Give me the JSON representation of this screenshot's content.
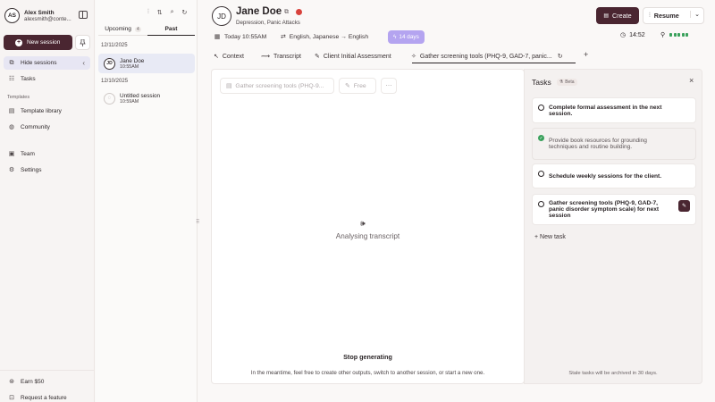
{
  "user": {
    "initials": "AS",
    "name": "Alex Smith",
    "email": "alexsmith@conte..."
  },
  "sidebar": {
    "new_session_label": "New session",
    "hide_sessions_label": "Hide sessions",
    "tasks_label": "Tasks",
    "templates_section": "Templates",
    "template_library_label": "Template library",
    "community_label": "Community",
    "team_label": "Team",
    "settings_label": "Settings",
    "earn_label": "Earn $50",
    "request_feature_label": "Request a feature"
  },
  "sessions_panel": {
    "tab_upcoming": "Upcoming",
    "tab_upcoming_badge": "4",
    "tab_past": "Past",
    "groups": [
      {
        "date": "12/11/2025",
        "name": "Jane Doe",
        "initials": "JD",
        "time": "10:55AM"
      },
      {
        "date": "12/10/2025",
        "name": "Untitled session",
        "initials": "",
        "time": "10:59AM"
      }
    ]
  },
  "patient": {
    "initials": "JD",
    "name": "Jane Doe",
    "conditions": "Depression, Panic Attacks",
    "date": "Today 10:55AM",
    "languages": "English, Japanese → English",
    "days_badge": "14 days",
    "timer": "14:52"
  },
  "header": {
    "create_label": "Create",
    "resume_label": "Resume"
  },
  "tabs": [
    {
      "label": "Context"
    },
    {
      "label": "Transcript"
    },
    {
      "label": "Client Initial Assessment"
    },
    {
      "label": "Gather screening tools (PHQ-9, GAD-7, panic..."
    }
  ],
  "editor": {
    "toolbar_template": "Gather screening tools (PHQ-9...",
    "toolbar_free": "Free",
    "status": "Analysing transcript",
    "stop_label": "Stop generating",
    "hint": "In the meantime, feel free to create other outputs, switch to another session, or start a new one."
  },
  "tasks_panel": {
    "title": "Tasks",
    "beta": "Beta",
    "items": [
      {
        "text": "Complete formal assessment in the next session.",
        "done": false
      },
      {
        "text": "Provide book resources for grounding techniques and routine building.",
        "done": true
      },
      {
        "text": "Schedule weekly sessions for the client.",
        "done": false
      },
      {
        "text": "Gather screening tools (PHQ-9, GAD-7, panic disorder symptom scale) for next session",
        "done": false
      }
    ],
    "new_task_label": "+ New task",
    "footer": "Stale tasks will be archived in 30 days."
  },
  "colors": {
    "brand": "#4a2631",
    "accent_purple": "#b4a4f0",
    "active_nav": "#e7e6f3",
    "done_green": "#3aa15c",
    "record_red": "#d8423c"
  }
}
